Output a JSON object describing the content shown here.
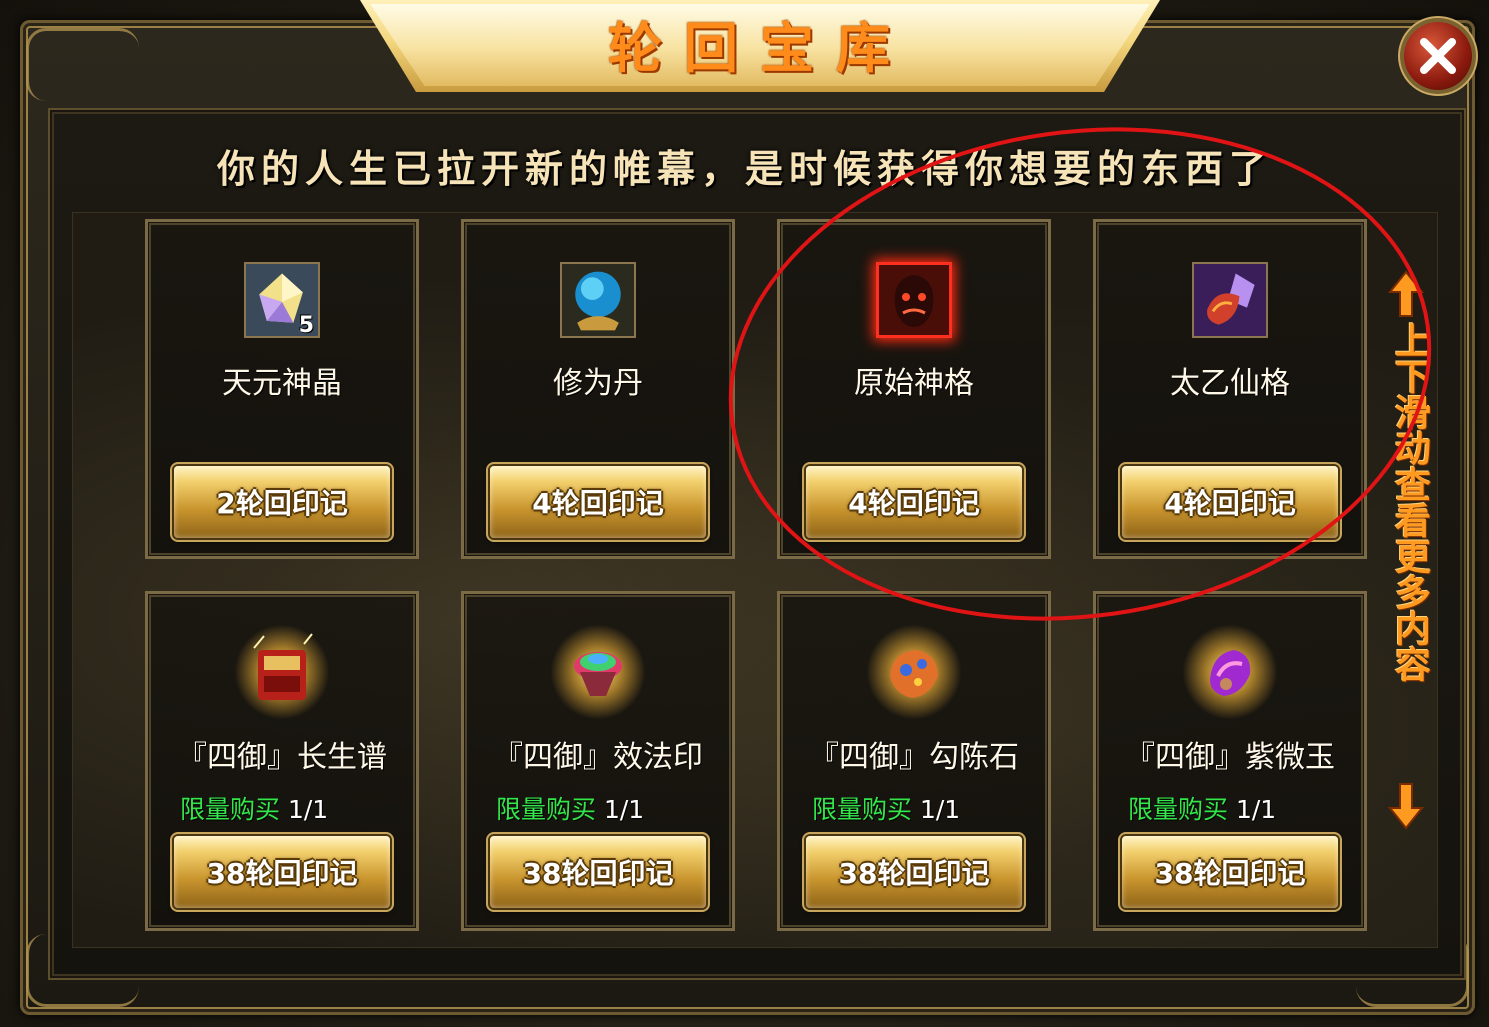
{
  "title": "轮回宝库",
  "subtitle": "你的人生已拉开新的帷幕，是时候获得你想要的东西了",
  "scroll_hint": "上下滑动查看更多内容",
  "items_row1": [
    {
      "name": "天元神晶",
      "qty": "5",
      "price": "2轮回印记",
      "icon": "crystal-icon"
    },
    {
      "name": "修为丹",
      "price": "4轮回印记",
      "icon": "orb-icon"
    },
    {
      "name": "原始神格",
      "price": "4轮回印记",
      "icon": "demon-mask-icon"
    },
    {
      "name": "太乙仙格",
      "price": "4轮回印记",
      "icon": "purple-gem-icon"
    }
  ],
  "items_row2": [
    {
      "name": "『四御』长生谱",
      "limit_label": "限量购买",
      "limit_value": "1/1",
      "price": "38轮回印记",
      "icon": "book-icon"
    },
    {
      "name": "『四御』效法印",
      "limit_label": "限量购买",
      "limit_value": "1/1",
      "price": "38轮回印记",
      "icon": "rainbow-seal-icon"
    },
    {
      "name": "『四御』勾陈石",
      "limit_label": "限量购买",
      "limit_value": "1/1",
      "price": "38轮回印记",
      "icon": "gem-stone-icon"
    },
    {
      "name": "『四御』紫微玉",
      "limit_label": "限量购买",
      "limit_value": "1/1",
      "price": "38轮回印记",
      "icon": "purple-jade-icon"
    }
  ],
  "colors": {
    "limit_green": "#33e64a",
    "title_orange": "#ff8c1a",
    "annotation_red": "#e01414"
  }
}
